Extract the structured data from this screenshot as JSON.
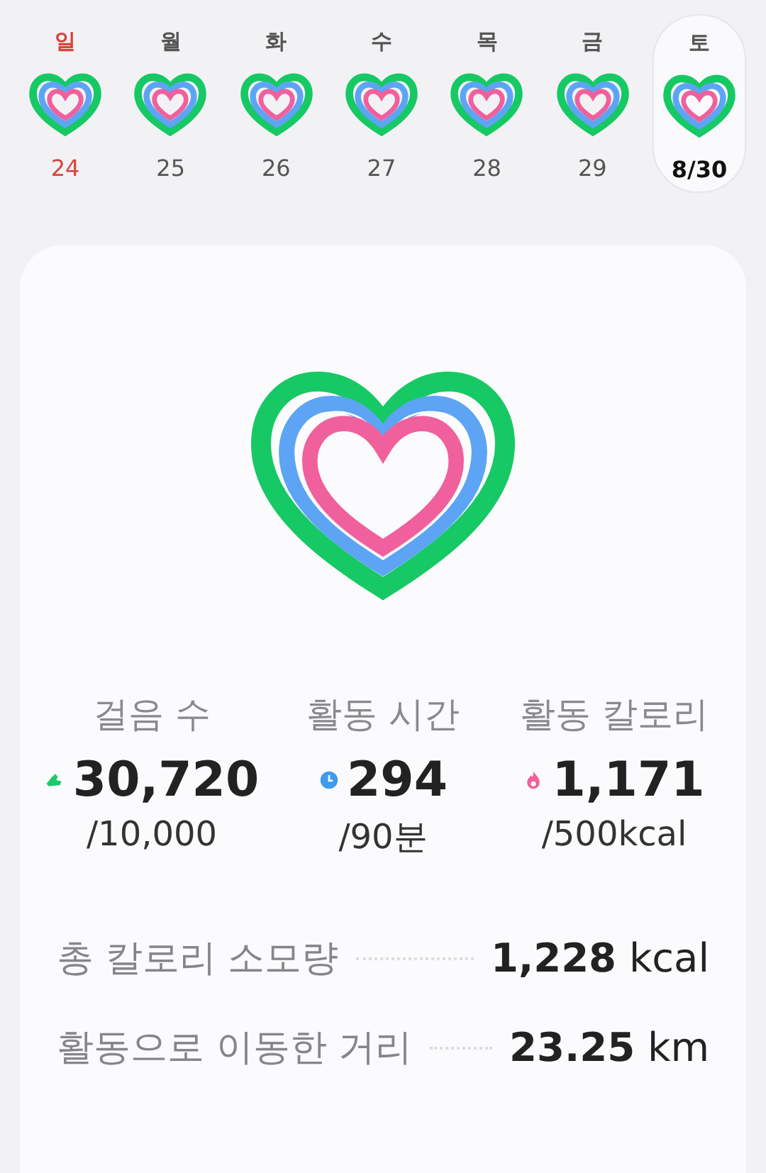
{
  "week": [
    {
      "weekday": "일",
      "date": "24",
      "holiday": true,
      "selected": false
    },
    {
      "weekday": "월",
      "date": "25",
      "holiday": false,
      "selected": false
    },
    {
      "weekday": "화",
      "date": "26",
      "holiday": false,
      "selected": false
    },
    {
      "weekday": "수",
      "date": "27",
      "holiday": false,
      "selected": false
    },
    {
      "weekday": "목",
      "date": "28",
      "holiday": false,
      "selected": false
    },
    {
      "weekday": "금",
      "date": "29",
      "holiday": false,
      "selected": false
    },
    {
      "weekday": "토",
      "date": "8/30",
      "holiday": false,
      "selected": true
    }
  ],
  "stats": [
    {
      "kind": "steps",
      "label": "걸음 수",
      "value": "30,720",
      "goal": "/10,000"
    },
    {
      "kind": "time",
      "label": "활동 시간",
      "value": "294",
      "goal": "/90분"
    },
    {
      "kind": "calories",
      "label": "활동 칼로리",
      "value": "1,171",
      "goal": "/500kcal"
    }
  ],
  "totals": [
    {
      "label": "총 칼로리 소모량",
      "value": "1,228",
      "unit": "kcal"
    },
    {
      "label": "활동으로 이동한 거리",
      "value": "23.25",
      "unit": "km"
    }
  ]
}
